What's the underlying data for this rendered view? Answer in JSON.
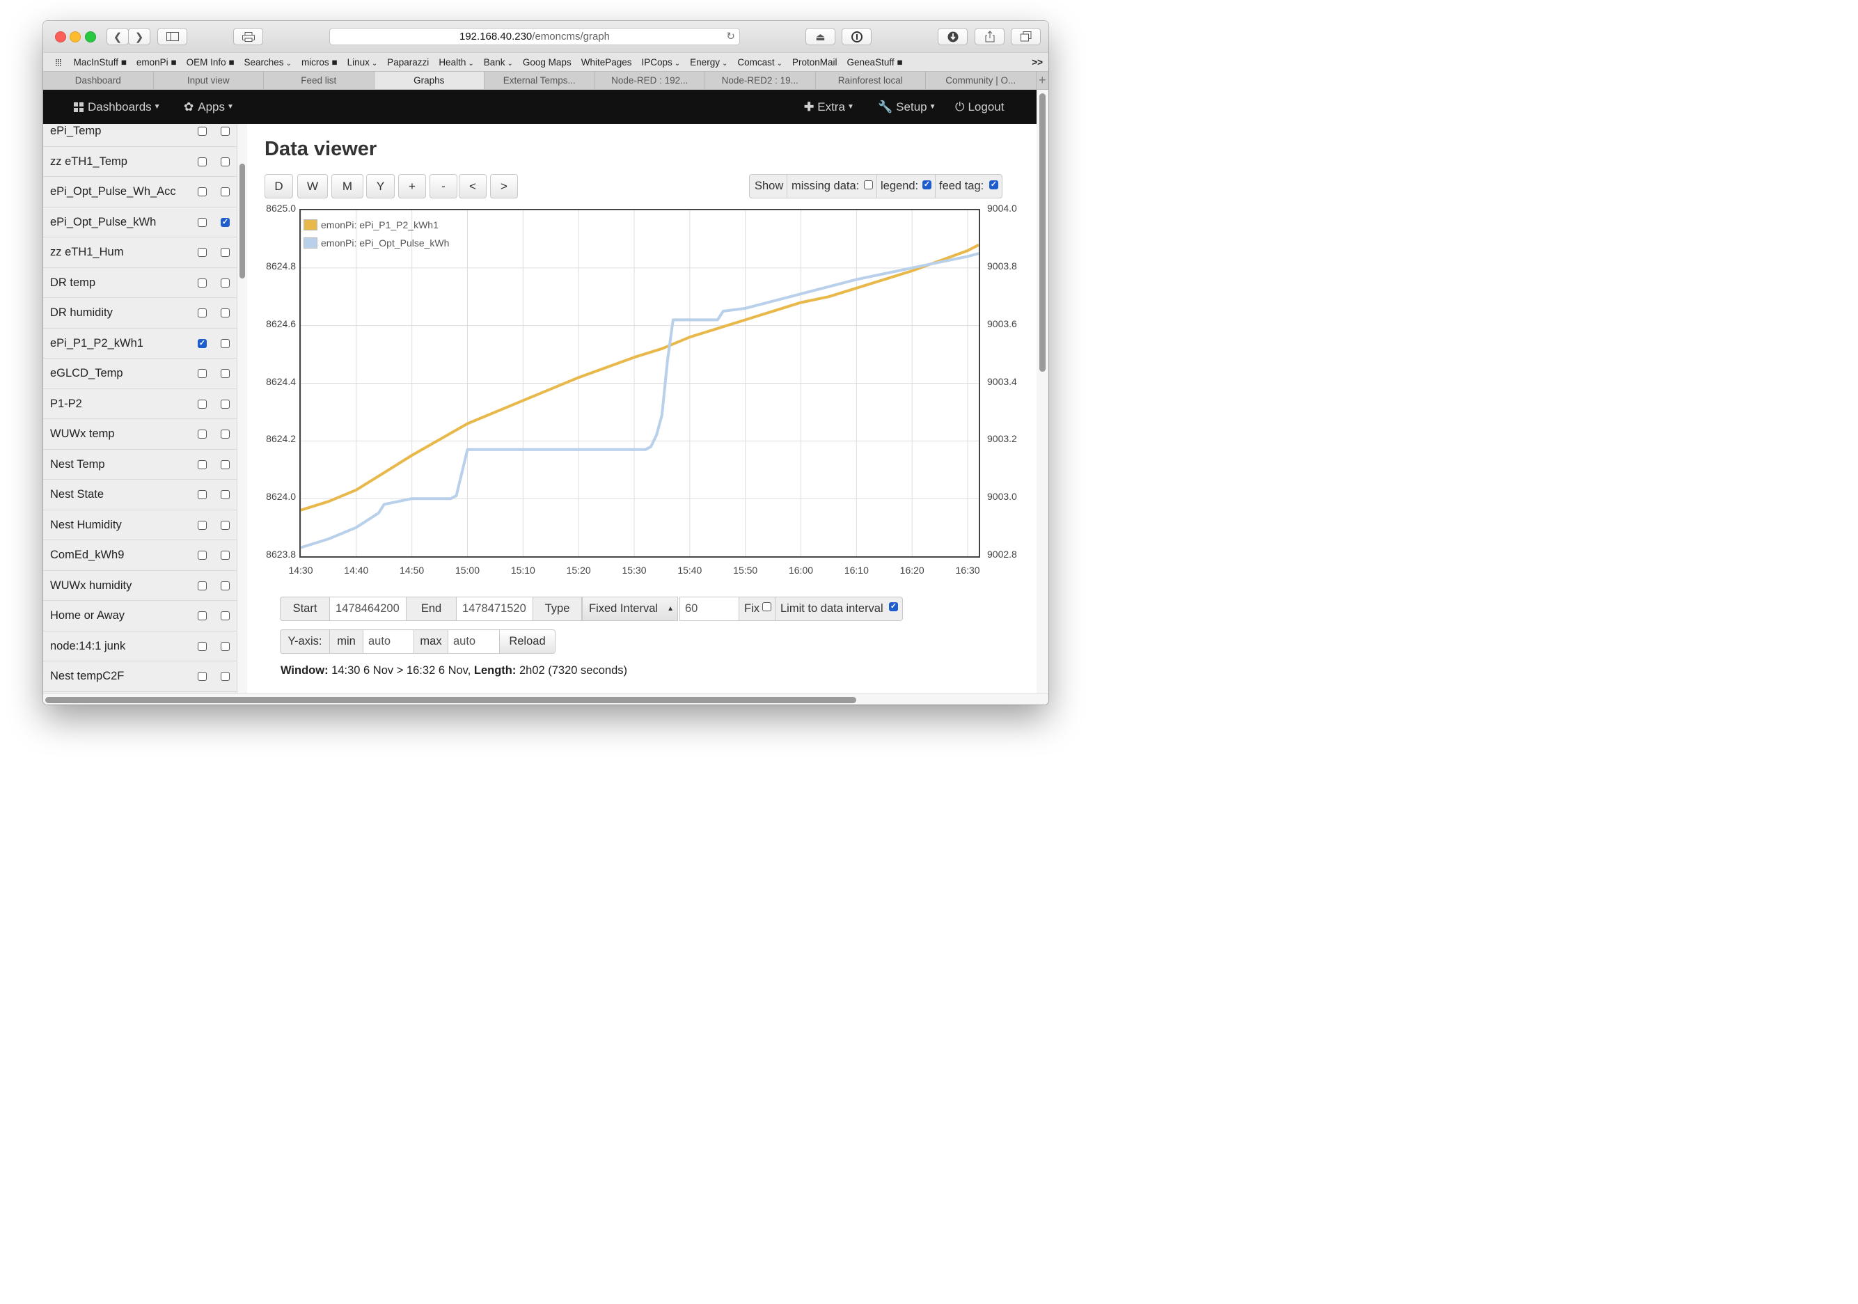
{
  "browser": {
    "url_host": "192.168.40.230",
    "url_path": "/emoncms/graph",
    "bookmarks": [
      {
        "label": "MacInStuff ■"
      },
      {
        "label": "emonPi ■"
      },
      {
        "label": "OEM Info ■"
      },
      {
        "label": "Searches",
        "dropdown": true
      },
      {
        "label": "micros ■"
      },
      {
        "label": "Linux",
        "dropdown": true
      },
      {
        "label": "Paparazzi"
      },
      {
        "label": "Health",
        "dropdown": true
      },
      {
        "label": "Bank",
        "dropdown": true
      },
      {
        "label": "Goog Maps"
      },
      {
        "label": "WhitePages"
      },
      {
        "label": "IPCops",
        "dropdown": true
      },
      {
        "label": "Energy",
        "dropdown": true
      },
      {
        "label": "Comcast",
        "dropdown": true
      },
      {
        "label": "ProtonMail"
      },
      {
        "label": "GeneaStuff ■"
      }
    ],
    "bookmarks_overflow": ">>",
    "tabs": [
      {
        "label": "Dashboard"
      },
      {
        "label": "Input view"
      },
      {
        "label": "Feed list"
      },
      {
        "label": "Graphs",
        "active": true
      },
      {
        "label": "External Temps..."
      },
      {
        "label": "Node-RED : 192..."
      },
      {
        "label": "Node-RED2 : 19..."
      },
      {
        "label": "Rainforest local"
      },
      {
        "label": "Community | O..."
      }
    ],
    "new_tab": "+"
  },
  "nav": {
    "dashboards": "Dashboards",
    "apps": "Apps",
    "extra": "Extra",
    "setup": "Setup",
    "logout": "Logout"
  },
  "feeds": [
    {
      "name": "ePi_Temp",
      "left": false,
      "right": false
    },
    {
      "name": "zz eTH1_Temp",
      "left": false,
      "right": false
    },
    {
      "name": "ePi_Opt_Pulse_Wh_Acc",
      "left": false,
      "right": false
    },
    {
      "name": "ePi_Opt_Pulse_kWh",
      "left": false,
      "right": true
    },
    {
      "name": "zz eTH1_Hum",
      "left": false,
      "right": false
    },
    {
      "name": "DR temp",
      "left": false,
      "right": false
    },
    {
      "name": "DR humidity",
      "left": false,
      "right": false
    },
    {
      "name": "ePi_P1_P2_kWh1",
      "left": true,
      "right": false
    },
    {
      "name": "eGLCD_Temp",
      "left": false,
      "right": false
    },
    {
      "name": "P1-P2",
      "left": false,
      "right": false
    },
    {
      "name": "WUWx temp",
      "left": false,
      "right": false
    },
    {
      "name": "Nest Temp",
      "left": false,
      "right": false
    },
    {
      "name": "Nest State",
      "left": false,
      "right": false
    },
    {
      "name": "Nest Humidity",
      "left": false,
      "right": false
    },
    {
      "name": "ComEd_kWh9",
      "left": false,
      "right": false
    },
    {
      "name": "WUWx humidity",
      "left": false,
      "right": false
    },
    {
      "name": "Home or Away",
      "left": false,
      "right": false
    },
    {
      "name": "node:14:1 junk",
      "left": false,
      "right": false
    },
    {
      "name": "Nest tempC2F",
      "left": false,
      "right": false
    }
  ],
  "viewer": {
    "title": "Data viewer",
    "buttons": [
      "D",
      "W",
      "M",
      "Y",
      "+",
      "-",
      "<",
      ">"
    ],
    "show": {
      "label": "Show",
      "missing_label": "missing data:",
      "missing": false,
      "legend_label": "legend:",
      "legend": true,
      "feedtag_label": "feed tag:",
      "feedtag": true
    },
    "start_label": "Start",
    "start": "1478464200",
    "end_label": "End",
    "end": "1478471520",
    "type_label": "Type",
    "type": "Fixed Interval",
    "interval": "60",
    "fix_label": "Fix",
    "fix": false,
    "limit_label": "Limit to data interval",
    "limit": true,
    "yaxis_label": "Y-axis:",
    "min_label": "min",
    "min": "auto",
    "max_label": "max",
    "max": "auto",
    "reload": "Reload",
    "window_label": "Window:",
    "window_text": "14:30 6 Nov > 16:32 6 Nov,",
    "length_label": "Length:",
    "length_text": "2h02 (7320 seconds)"
  },
  "chart_data": {
    "type": "line",
    "xlabel": "",
    "x_ticks": [
      "14:30",
      "14:40",
      "14:50",
      "15:00",
      "15:10",
      "15:20",
      "15:30",
      "15:40",
      "15:50",
      "16:00",
      "16:10",
      "16:20",
      "16:30"
    ],
    "xlim_minutes": [
      0,
      122
    ],
    "y_left_ticks": [
      "8625.0",
      "8624.8",
      "8624.6",
      "8624.4",
      "8624.2",
      "8624.0",
      "8623.8"
    ],
    "ylim_left": [
      8623.8,
      8625.0
    ],
    "y_right_ticks": [
      "9004.0",
      "9003.8",
      "9003.6",
      "9003.4",
      "9003.2",
      "9003.0",
      "9002.8"
    ],
    "ylim_right": [
      9002.8,
      9004.0
    ],
    "grid": true,
    "legend_position": "top-left",
    "series": [
      {
        "name": "emonPi: ePi_P1_P2_kWh1",
        "axis": "left",
        "color": "#e8b94a",
        "x_minutes": [
          0,
          5,
          10,
          15,
          20,
          30,
          40,
          50,
          60,
          65,
          70,
          80,
          90,
          95,
          100,
          110,
          120,
          122
        ],
        "values": [
          8623.96,
          8623.99,
          8624.03,
          8624.09,
          8624.15,
          8624.26,
          8624.34,
          8624.42,
          8624.49,
          8624.52,
          8624.56,
          8624.62,
          8624.68,
          8624.7,
          8624.73,
          8624.79,
          8624.86,
          8624.88
        ]
      },
      {
        "name": "emonPi: ePi_Opt_Pulse_kWh",
        "axis": "right",
        "color": "#b8d0ea",
        "x_minutes": [
          0,
          5,
          10,
          14,
          15,
          20,
          26,
          27,
          28,
          30,
          40,
          50,
          60,
          62,
          63,
          64,
          65,
          66,
          67,
          70,
          75,
          76,
          80,
          90,
          100,
          110,
          120,
          122
        ],
        "values": [
          9002.83,
          9002.86,
          9002.9,
          9002.95,
          9002.98,
          9003.0,
          9003.0,
          9003.0,
          9003.01,
          9003.17,
          9003.17,
          9003.17,
          9003.17,
          9003.17,
          9003.18,
          9003.22,
          9003.29,
          9003.48,
          9003.62,
          9003.62,
          9003.62,
          9003.65,
          9003.66,
          9003.71,
          9003.76,
          9003.8,
          9003.84,
          9003.85
        ]
      }
    ]
  }
}
